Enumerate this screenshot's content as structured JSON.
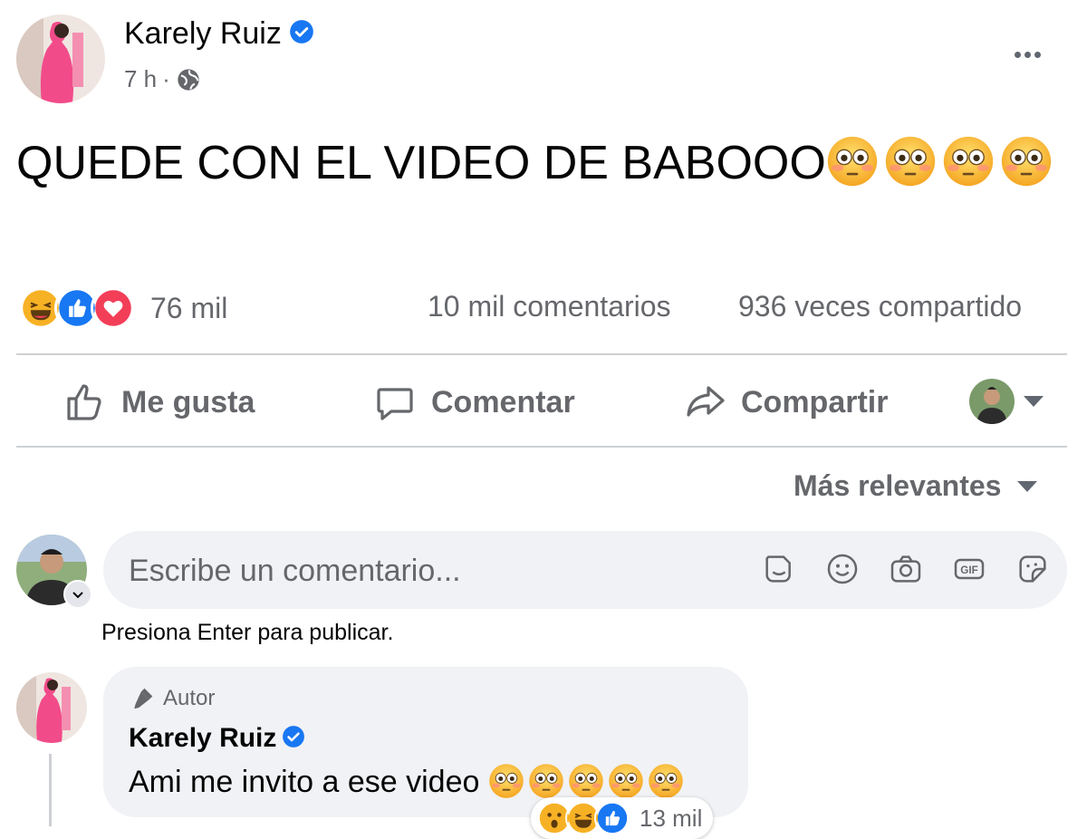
{
  "post": {
    "author": "Karely Ruiz",
    "time": "7 h",
    "separator": "·",
    "text": "QUEDE CON EL VIDEO DE BABOOO",
    "reaction_count": "76 mil",
    "comments_count": "10 mil comentarios",
    "shares_count": "936 veces compartido"
  },
  "actions": {
    "like": "Me gusta",
    "comment": "Comentar",
    "share": "Compartir"
  },
  "sort": {
    "label": "Más relevantes"
  },
  "composer": {
    "placeholder": "Escribe un comentario...",
    "hint": "Presiona Enter para publicar."
  },
  "comment": {
    "badge": "Autor",
    "author": "Karely Ruiz",
    "text": "Ami me invito a ese video",
    "reaction_count": "13 mil"
  },
  "colors": {
    "brand_blue": "#1877f2",
    "love_red": "#f33e58",
    "haha_yellow": "#f7b125",
    "muted_text": "#65676b",
    "bubble_bg": "#f0f2f5"
  },
  "icons": [
    "globe-icon",
    "verified-icon",
    "more-icon",
    "like-icon",
    "comment-icon",
    "share-icon",
    "sticker-icon",
    "emoji-icon",
    "camera-icon",
    "gif-icon",
    "sticker-face-icon",
    "microphone-icon",
    "flushed-emoji"
  ]
}
